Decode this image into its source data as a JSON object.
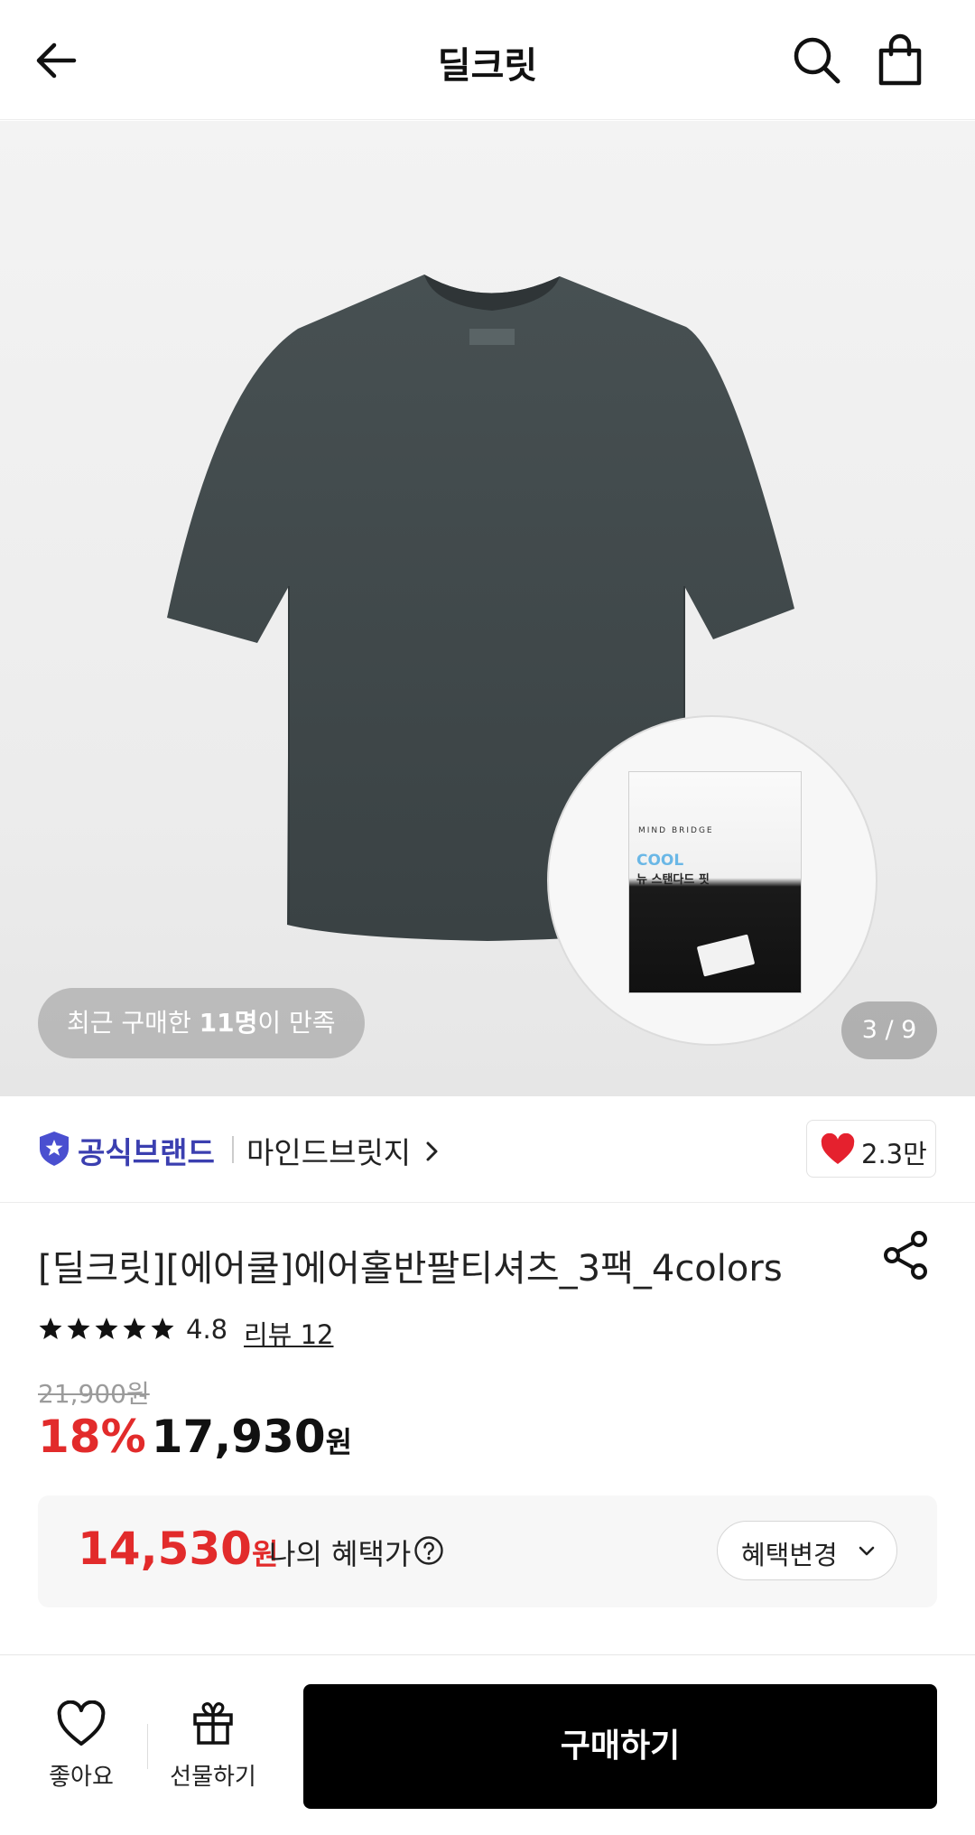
{
  "header": {
    "title": "딜크릿",
    "icons": [
      "back-arrow-icon",
      "search-icon",
      "shopping-bag-icon"
    ]
  },
  "hero": {
    "satisfaction_prefix": "최근 구매한 ",
    "satisfaction_count": "11명",
    "satisfaction_suffix": "이 만족",
    "image_counter": "3 / 9",
    "pack_brand": "MIND BRIDGE",
    "pack_cool": "COOL",
    "pack_sub": "뉴 스탠다드 핏"
  },
  "brand": {
    "official_label": "공식브랜드",
    "name": "마인드브릿지",
    "like_count": "2.3만",
    "colors": {
      "official": "#3b3fb0",
      "heart": "#e5212e"
    }
  },
  "product": {
    "title": "[딜크릿][에어쿨]에어홀반팔티셔츠_3팩_4colors",
    "rating": 4.8,
    "rating_text": "4.8",
    "reviews_label": "리뷰 12",
    "original_price": "21,900원",
    "discount": "18%",
    "price": "17,930",
    "currency": "원"
  },
  "benefit": {
    "price": "14,530",
    "currency": "원",
    "label": "나의 혜택가",
    "change_label": "혜택변경",
    "accent": "#e22b2b"
  },
  "bottom_bar": {
    "like_label": "좋아요",
    "gift_label": "선물하기",
    "buy_label": "구매하기"
  }
}
